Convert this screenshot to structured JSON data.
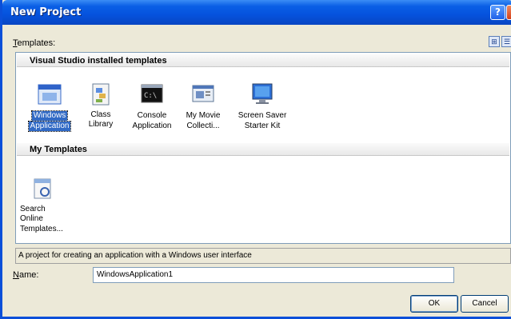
{
  "window": {
    "title": "New Project"
  },
  "titlebar": {
    "help_label": "?",
    "close_label": "×"
  },
  "templates_label": "Templates:",
  "view_buttons": [
    "large-icons-view",
    "small-icons-view"
  ],
  "groups": [
    {
      "header": "Visual Studio installed templates",
      "items": [
        {
          "label_lines": [
            "Windows",
            "Application"
          ],
          "icon": "window-app-icon",
          "selected": true
        },
        {
          "label_lines": [
            "Class Library"
          ],
          "icon": "class-library-icon",
          "selected": false
        },
        {
          "label_lines": [
            "Console",
            "Application"
          ],
          "icon": "console-app-icon",
          "selected": false
        },
        {
          "label_lines": [
            "My Movie",
            "Collecti..."
          ],
          "icon": "movie-collection-icon",
          "selected": false
        },
        {
          "label_lines": [
            "Screen Saver",
            "Starter Kit"
          ],
          "icon": "screen-saver-icon",
          "selected": false
        }
      ]
    },
    {
      "header": "My Templates",
      "items": [
        {
          "label_lines": [
            "Search Online",
            "Templates..."
          ],
          "icon": "search-online-icon",
          "selected": false
        }
      ]
    }
  ],
  "description": "A project for creating an application with a Windows user interface",
  "name_field": {
    "label": "Name:",
    "value": "WindowsApplication1"
  },
  "buttons": {
    "ok": "OK",
    "cancel": "Cancel"
  },
  "colors": {
    "titlebar": "#0552dd",
    "selection": "#316ac5",
    "dialog_bg": "#ece9d8"
  }
}
